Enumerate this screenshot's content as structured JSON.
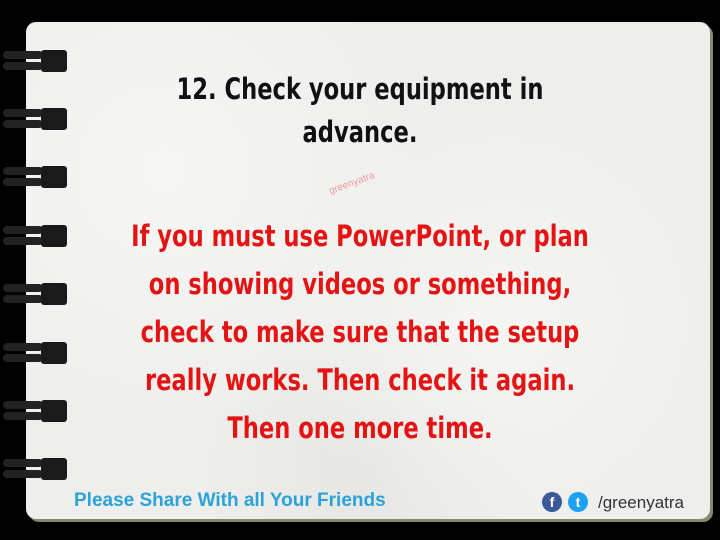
{
  "title": "12. Check your equipment in advance.",
  "body_lines": [
    "If you must use PowerPoint, or plan",
    "on showing videos or something,",
    "check to make sure that the setup",
    "really works. Then check it again.",
    "Then one more time."
  ],
  "watermark": "greenyatra",
  "footer": {
    "share_text": "Please Share With all Your Friends",
    "handle": "/greenyatra",
    "facebook_glyph": "f",
    "twitter_glyph": "t"
  },
  "colors": {
    "title": "#111111",
    "body": "#e41414",
    "share": "#2ba3d6",
    "facebook": "#3b5998",
    "twitter": "#1da1f2"
  }
}
